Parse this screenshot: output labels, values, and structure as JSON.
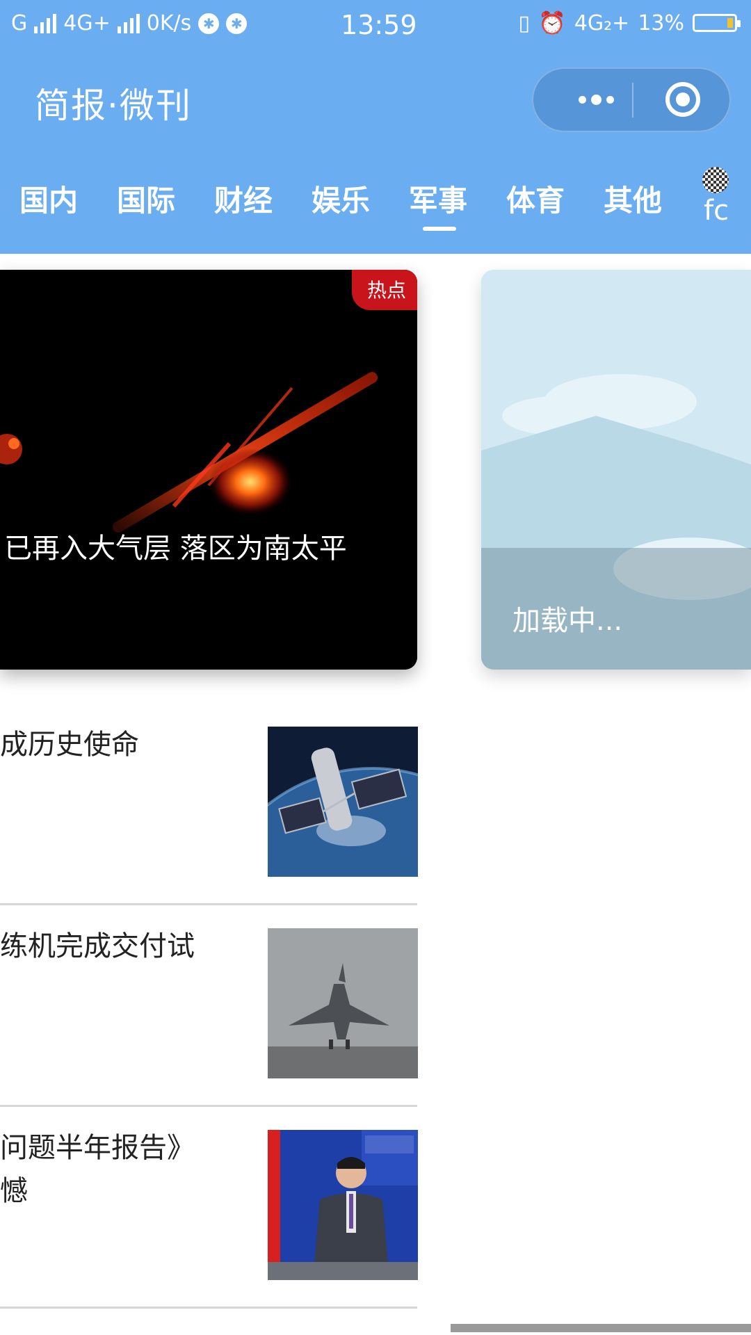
{
  "status_bar": {
    "carrier": "G",
    "network": "4G+",
    "speed": "0K/s",
    "time": "13:59",
    "network_right": "4G₂+",
    "battery_percent": "13%",
    "battery_level": 0.13
  },
  "header": {
    "title": "简报·微刊",
    "capsule": {
      "more_icon": "more-dots-icon",
      "close_icon": "close-target-icon"
    }
  },
  "tabs": [
    {
      "label": "国内",
      "active": false
    },
    {
      "label": "国际",
      "active": false
    },
    {
      "label": "财经",
      "active": false
    },
    {
      "label": "娱乐",
      "active": false
    },
    {
      "label": "军事",
      "active": true
    },
    {
      "label": "体育",
      "active": false
    },
    {
      "label": "其他",
      "active": false
    }
  ],
  "user": {
    "name": "fc"
  },
  "hero": {
    "badge": "热点",
    "caption": "已再入大气层 落区为南太平"
  },
  "second_card": {
    "loading_text": "加载中..."
  },
  "news": [
    {
      "title": "成历史使命",
      "thumb": "space-station"
    },
    {
      "title": "练机完成交付试",
      "thumb": "fighter-jet"
    },
    {
      "title": "问题半年报告》",
      "title_line2": "憾",
      "thumb": "press-conference"
    }
  ]
}
